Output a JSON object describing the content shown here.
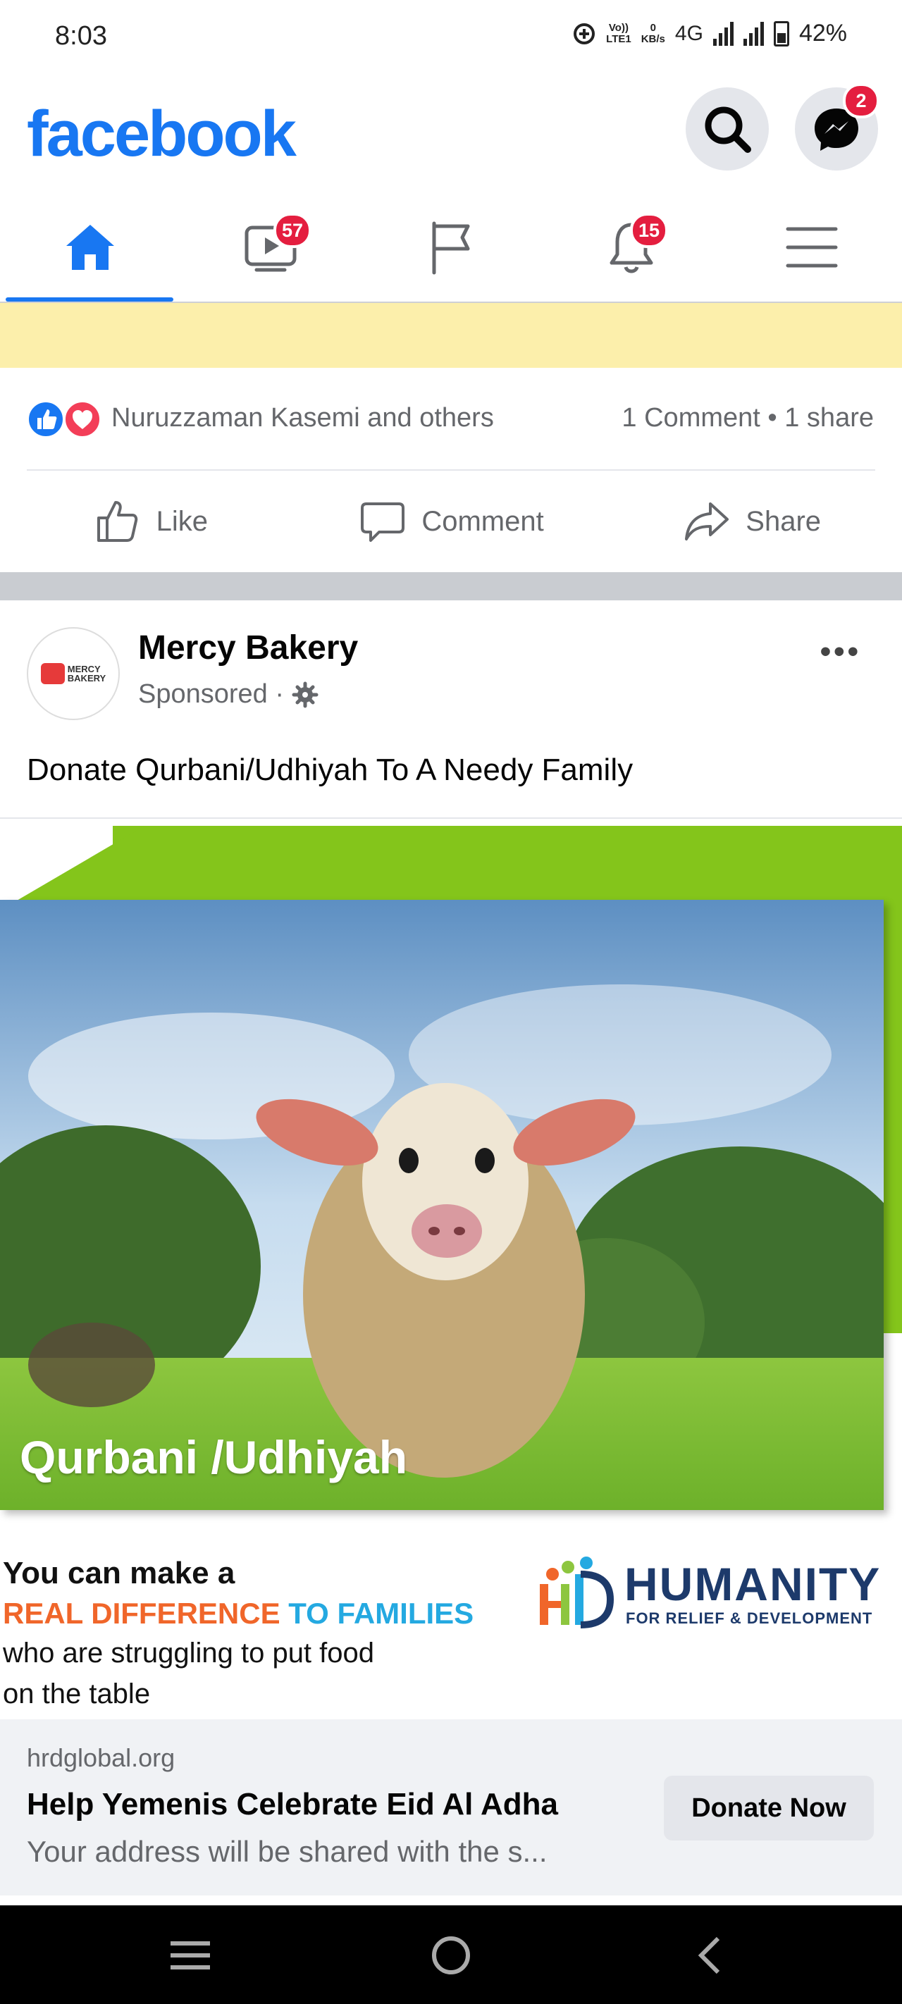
{
  "status_bar": {
    "time": "8:03",
    "lte_label_top": "Vo))",
    "lte_label_bottom": "LTE1",
    "speed_value": "0",
    "speed_unit": "KB/s",
    "network": "4G",
    "battery": "42%"
  },
  "header": {
    "logo_text": "facebook",
    "messenger_badge": "2",
    "brand_color": "#1877f2"
  },
  "nav": {
    "tabs": [
      {
        "name": "home",
        "icon": "home-icon",
        "active": true
      },
      {
        "name": "watch",
        "icon": "video-icon",
        "badge": "57"
      },
      {
        "name": "pages",
        "icon": "flag-icon"
      },
      {
        "name": "notifications",
        "icon": "bell-icon",
        "badge": "15"
      },
      {
        "name": "menu",
        "icon": "hamburger-icon"
      }
    ]
  },
  "previous_post": {
    "reaction_names": "Nuruzzaman Kasemi and others",
    "comment_share": "1 Comment • 1 share",
    "actions": {
      "like": "Like",
      "comment": "Comment",
      "share": "Share"
    }
  },
  "sponsored_post": {
    "page_name": "Mercy Bakery",
    "avatar_text_line1": "MERCY",
    "avatar_text_line2": "BAKERY",
    "sponsored_label": "Sponsored ·",
    "text": "Donate Qurbani/Udhiyah  To A Needy Family",
    "ad": {
      "caption": "Qurbani /Udhiyah",
      "line1": "You can make a",
      "line2_orange": "REAL DIFFERENCE",
      "line2_blue": " TO FAMILIES",
      "line3": "who are struggling to put food",
      "line4": "on the table",
      "logo_name": "HUMANITY",
      "logo_sub": "FOR RELIEF & DEVELOPMENT"
    },
    "link": {
      "domain": "hrdglobal.org",
      "title": "Help Yemenis Celebrate Eid Al Adha",
      "description": "Your address will be shared with the s...",
      "cta": "Donate Now"
    }
  }
}
